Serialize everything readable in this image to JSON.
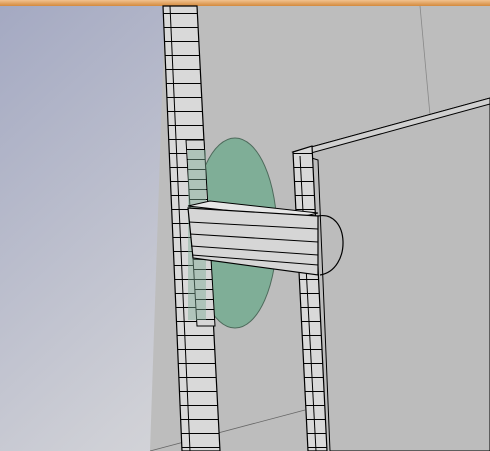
{
  "viewport": {
    "kind": "3d-model-view",
    "colors": {
      "background_top": "#a7acc3",
      "background_bottom": "#e0e0e0",
      "surface": "#bdbdbd",
      "edge": "#000000",
      "slab_face": "#d8d8d8",
      "slab_side": "#ababab",
      "dielectric": "#7fae97",
      "accent_bar": "#d48a3d"
    }
  }
}
